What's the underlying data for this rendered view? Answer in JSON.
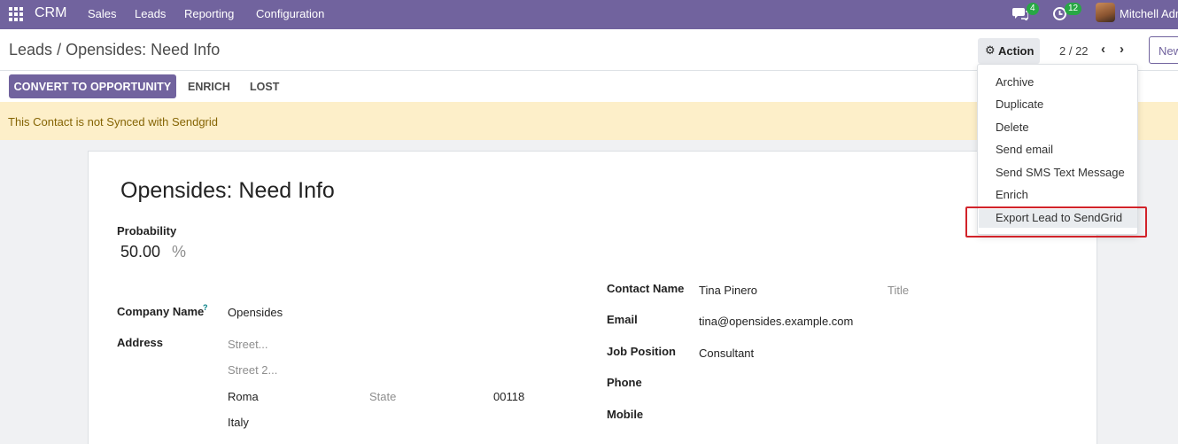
{
  "navbar": {
    "brand": "CRM",
    "menu": [
      "Sales",
      "Leads",
      "Reporting",
      "Configuration"
    ],
    "messages_count": "4",
    "activities_count": "12",
    "user_name": "Mitchell Admin",
    "icons": [
      "apps-grid-icon",
      "chat-icon",
      "clock-icon",
      "avatar"
    ]
  },
  "breadcrumb": {
    "parent": "Leads",
    "separator": "/",
    "current": "Opensides: Need Info"
  },
  "controls": {
    "action_label": "Action",
    "pager": "2 / 22",
    "new_label": "New"
  },
  "statusbar": {
    "convert_label": "CONVERT TO OPPORTUNITY",
    "enrich_label": "ENRICH",
    "lost_label": "LOST"
  },
  "alert": {
    "text": "This Contact is not Synced with Sendgrid"
  },
  "form": {
    "title": "Opensides: Need Info",
    "probability_label": "Probability",
    "probability_value": "50.00",
    "probability_unit": "%",
    "company_name_label": "Company Name",
    "company_help": "?",
    "company_name_value": "Opensides",
    "address_label": "Address",
    "street_placeholder": "Street...",
    "street2_placeholder": "Street 2...",
    "city": "Roma",
    "state_placeholder": "State",
    "zip": "00118",
    "country": "Italy",
    "contact_name_label": "Contact Name",
    "contact_name_value": "Tina Pinero",
    "title_placeholder": "Title",
    "email_label": "Email",
    "email_value": "tina@opensides.example.com",
    "job_position_label": "Job Position",
    "job_position_value": "Consultant",
    "phone_label": "Phone",
    "mobile_label": "Mobile"
  },
  "action_menu": {
    "items": [
      "Archive",
      "Duplicate",
      "Delete",
      "Send email",
      "Send SMS Text Message",
      "Enrich",
      "Export Lead to SendGrid"
    ],
    "highlighted_item": "Export Lead to SendGrid",
    "highlight_color": "#d2232a"
  },
  "colors": {
    "brand": "#71639e",
    "alert_bg": "#fdefc9",
    "alert_text": "#856404",
    "badge": "#28a745"
  }
}
